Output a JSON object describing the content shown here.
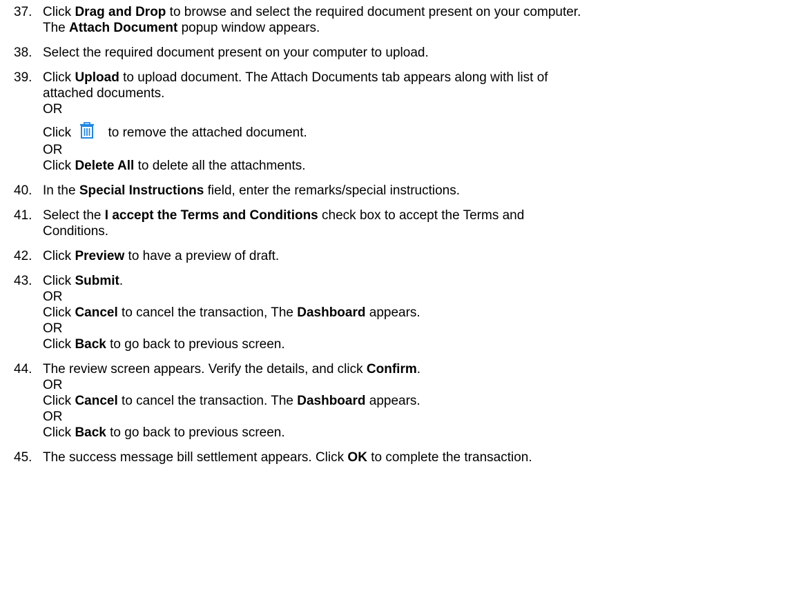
{
  "steps": [
    {
      "num": "37.",
      "line1": {
        "t1": "Click ",
        "b1": "Drag and Drop",
        "t2": " to browse and select the required document present on your computer."
      },
      "line2": {
        "t1": "The ",
        "b1": "Attach Document",
        "t2": " popup window appears."
      }
    },
    {
      "num": "38.",
      "line1": {
        "t1": "Select the required document present on your computer to upload."
      }
    },
    {
      "num": "39.",
      "line1": {
        "t1": "Click ",
        "b1": "Upload",
        "t2": " to upload document. The Attach Documents tab appears along with list of"
      },
      "line2": {
        "t1": "attached documents."
      },
      "or1": "OR",
      "icon_line": {
        "t1": "Click",
        "icon": "trash-icon",
        "t2": " to remove the attached document."
      },
      "or2": "OR",
      "line3": {
        "t1": "Click ",
        "b1": "Delete All",
        "t2": " to delete all the attachments."
      }
    },
    {
      "num": "40.",
      "line1": {
        "t1": "In the ",
        "b1": "Special Instructions",
        "t2": " field, enter the remarks/special instructions."
      }
    },
    {
      "num": "41.",
      "line1": {
        "t1": "Select the ",
        "b1": "I accept the Terms and Conditions",
        "t2": " check box to accept the Terms and"
      },
      "line2": {
        "t1": "Conditions."
      }
    },
    {
      "num": "42.",
      "line1": {
        "t1": "Click ",
        "b1": "Preview",
        "t2": " to have a preview of draft."
      }
    },
    {
      "num": "43.",
      "line1": {
        "t1": "Click ",
        "b1": "Submit",
        "t2": "."
      },
      "or1": "OR",
      "line2": {
        "t1": "Click ",
        "b1": "Cancel",
        "t2": " to cancel the transaction, The ",
        "b2": "Dashboard",
        "t3": " appears."
      },
      "or2": "OR",
      "line3": {
        "t1": "Click ",
        "b1": "Back",
        "t2": " to go back to previous screen."
      }
    },
    {
      "num": "44.",
      "line1": {
        "t1": "The review screen appears. Verify the details, and click ",
        "b1": "Confirm",
        "t2": "."
      },
      "or1": "OR",
      "line2": {
        "t1": "Click ",
        "b1": "Cancel",
        "t2": " to cancel the transaction. The ",
        "b2": "Dashboard",
        "t3": " appears."
      },
      "or2": "OR",
      "line3": {
        "t1": "Click ",
        "b1": "Back",
        "t2": " to go back to previous screen."
      }
    },
    {
      "num": "45.",
      "line1": {
        "t1": "The success message bill settlement appears. Click ",
        "b1": "OK",
        "t2": " to complete the transaction."
      }
    }
  ],
  "colors": {
    "text": "#000000",
    "icon": "#1e88e5"
  }
}
